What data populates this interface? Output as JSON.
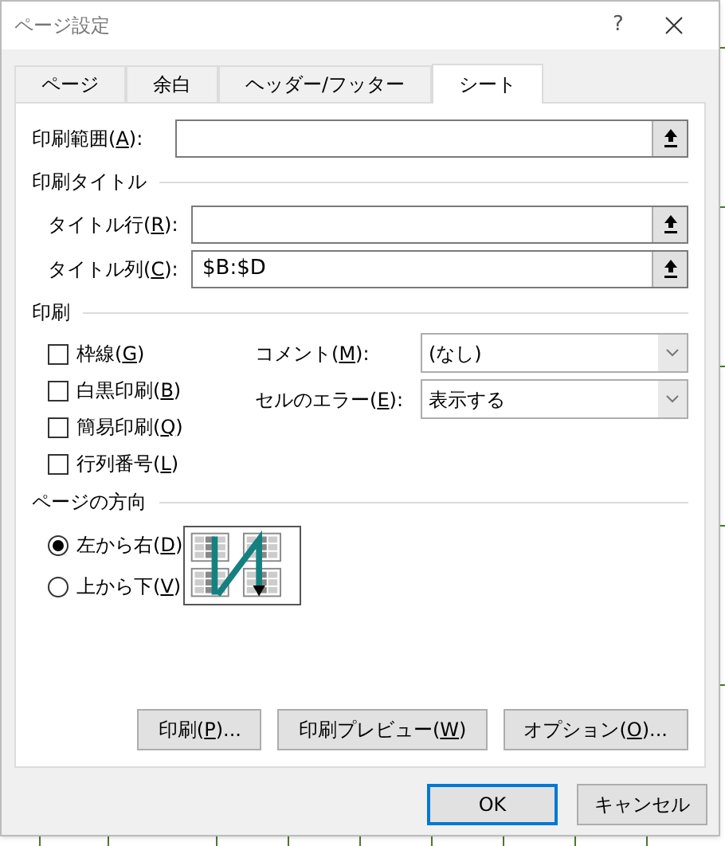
{
  "window": {
    "title": "ページ設定",
    "help": "?"
  },
  "tabs": [
    {
      "label": "ページ",
      "selected": false
    },
    {
      "label": "余白",
      "selected": false
    },
    {
      "label": "ヘッダー/フッター",
      "selected": false
    },
    {
      "label": "シート",
      "selected": true
    }
  ],
  "print_area": {
    "label": {
      "text": "印刷範囲(",
      "key": "A",
      "after": "):"
    }
  },
  "print_titles": {
    "heading": "印刷タイトル",
    "fields": [
      {
        "label": {
          "text": "タイトル行(",
          "key": "R",
          "after": "):"
        }
      },
      {
        "label": {
          "text": "タイトル列(",
          "key": "C",
          "after": "):"
        },
        "value": "$B:$D"
      }
    ]
  },
  "print": {
    "heading": "印刷",
    "options": [
      {
        "label": {
          "text": "枠線(",
          "key": "G",
          "after": ")"
        },
        "checked": false
      },
      {
        "label": {
          "text": "白黒印刷(",
          "key": "B",
          "after": ")"
        },
        "checked": false
      },
      {
        "label": {
          "text": "簡易印刷(",
          "key": "Q",
          "after": ")"
        },
        "checked": false
      },
      {
        "label": {
          "text": "行列番号(",
          "key": "L",
          "after": ")"
        },
        "checked": false
      }
    ],
    "dropdowns": [
      {
        "label": {
          "text": "コメント(",
          "key": "M",
          "after": "):"
        },
        "value": "(なし)"
      },
      {
        "label": {
          "text": "セルのエラー(",
          "key": "E",
          "after": "):"
        },
        "value": "表示する"
      }
    ]
  },
  "page_order": {
    "heading": "ページの方向",
    "options": [
      {
        "label": {
          "text": "左から右(",
          "key": "D",
          "after": ")"
        },
        "selected": true
      },
      {
        "label": {
          "text": "上から下(",
          "key": "V",
          "after": ")"
        },
        "selected": false
      }
    ]
  },
  "sheet_buttons": [
    {
      "text": "印刷(",
      "key": "P",
      "after": ")..."
    },
    {
      "text": "印刷プレビュー(",
      "key": "W",
      "after": ")"
    },
    {
      "text": "オプション(",
      "key": "O",
      "after": ")..."
    }
  ],
  "footer_buttons": [
    {
      "label": "OK",
      "focused": true
    },
    {
      "label": "キャンセル",
      "focused": false
    }
  ]
}
